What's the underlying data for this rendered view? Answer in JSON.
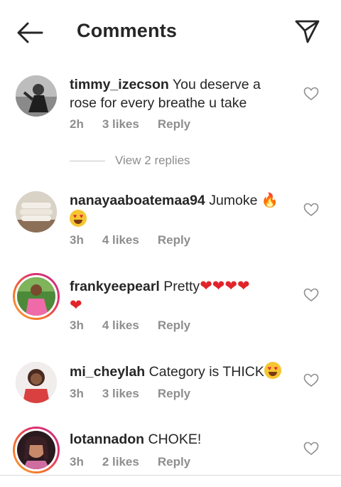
{
  "header": {
    "title": "Comments",
    "back_icon": "arrow-left-icon",
    "send_icon": "paper-plane-icon"
  },
  "view_replies_label": "View 2 replies",
  "comments": [
    {
      "username": "timmy_izecson",
      "text": " You deserve a rose for every breathe u take",
      "time": "2h",
      "likes": "3 likes",
      "reply": "Reply"
    },
    {
      "username": "nanayaaboatemaa94",
      "text": " Jumoke ",
      "time": "3h",
      "likes": "4 likes",
      "reply": "Reply"
    },
    {
      "username": "frankyeepearl",
      "text": " Pretty",
      "time": "3h",
      "likes": "4 likes",
      "reply": "Reply"
    },
    {
      "username": "mi_cheylah",
      "text": " Category is THICK",
      "time": "3h",
      "likes": "3 likes",
      "reply": "Reply"
    },
    {
      "username": "lotannadon",
      "text": " CHOKE!",
      "time": "3h",
      "likes": "2 likes",
      "reply": "Reply"
    }
  ],
  "colors": {
    "accent_text": "#262626",
    "muted": "#8e8e8e",
    "heart_emoji": "#e0252a",
    "story_ring": "#e1306c"
  }
}
